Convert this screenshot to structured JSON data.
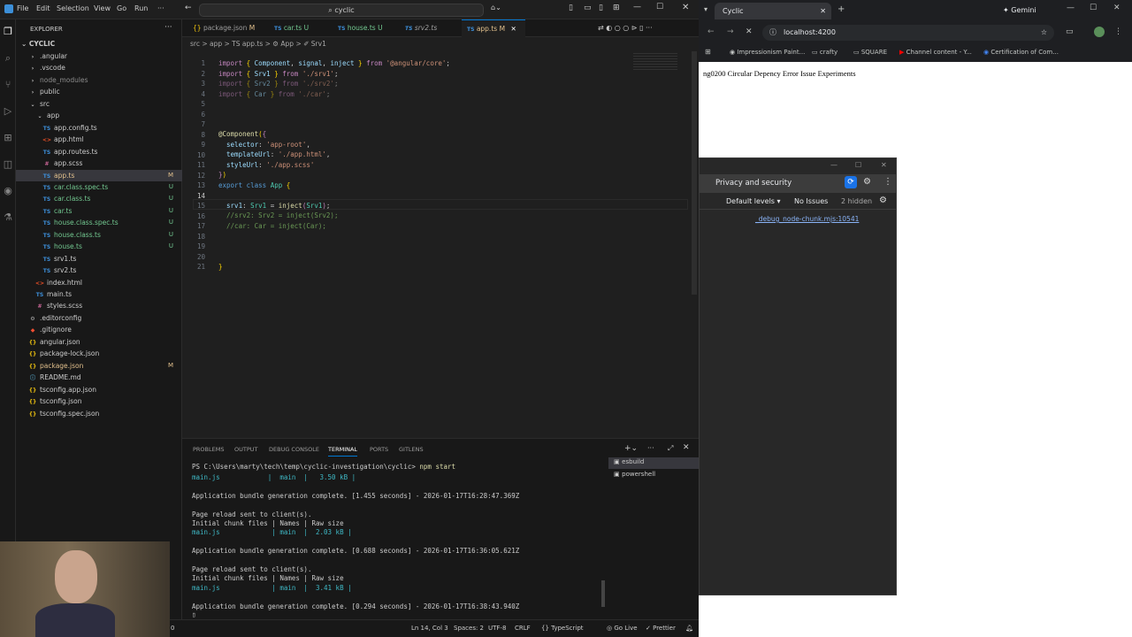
{
  "vscode": {
    "menu": [
      "File",
      "Edit",
      "Selection",
      "View",
      "Go",
      "Run",
      "···"
    ],
    "command_center": "cyclic",
    "explorer": {
      "title": "EXPLORER",
      "root": "CYCLIC",
      "items": [
        {
          "label": ".angular",
          "type": "folder",
          "depth": 1,
          "status": ""
        },
        {
          "label": ".vscode",
          "type": "folder",
          "depth": 1,
          "status": ""
        },
        {
          "label": "node_modules",
          "type": "folder",
          "depth": 1,
          "status": ""
        },
        {
          "label": "public",
          "type": "folder",
          "depth": 1,
          "status": ""
        },
        {
          "label": "src",
          "type": "folder-open",
          "depth": 1,
          "status": ""
        },
        {
          "label": "app",
          "type": "folder-open",
          "depth": 2,
          "status": ""
        },
        {
          "label": "app.config.ts",
          "type": "ts",
          "depth": 3,
          "status": ""
        },
        {
          "label": "app.html",
          "type": "html",
          "depth": 3,
          "status": ""
        },
        {
          "label": "app.routes.ts",
          "type": "ts",
          "depth": 3,
          "status": ""
        },
        {
          "label": "app.scss",
          "type": "scss",
          "depth": 3,
          "status": ""
        },
        {
          "label": "app.ts",
          "type": "ts",
          "depth": 3,
          "status": "M"
        },
        {
          "label": "car.class.spec.ts",
          "type": "ts",
          "depth": 3,
          "status": "U"
        },
        {
          "label": "car.class.ts",
          "type": "ts",
          "depth": 3,
          "status": "U"
        },
        {
          "label": "car.ts",
          "type": "ts",
          "depth": 3,
          "status": "U"
        },
        {
          "label": "house.class.spec.ts",
          "type": "ts",
          "depth": 3,
          "status": "U"
        },
        {
          "label": "house.class.ts",
          "type": "ts",
          "depth": 3,
          "status": "U"
        },
        {
          "label": "house.ts",
          "type": "ts",
          "depth": 3,
          "status": "U"
        },
        {
          "label": "srv1.ts",
          "type": "ts",
          "depth": 3,
          "status": ""
        },
        {
          "label": "srv2.ts",
          "type": "ts",
          "depth": 3,
          "status": ""
        },
        {
          "label": "index.html",
          "type": "html",
          "depth": 2,
          "status": ""
        },
        {
          "label": "main.ts",
          "type": "ts",
          "depth": 2,
          "status": ""
        },
        {
          "label": "styles.scss",
          "type": "scss",
          "depth": 2,
          "status": ""
        },
        {
          "label": ".editorconfig",
          "type": "cfg",
          "depth": 1,
          "status": ""
        },
        {
          "label": ".gitignore",
          "type": "git",
          "depth": 1,
          "status": ""
        },
        {
          "label": "angular.json",
          "type": "json",
          "depth": 1,
          "status": ""
        },
        {
          "label": "package-lock.json",
          "type": "json",
          "depth": 1,
          "status": ""
        },
        {
          "label": "package.json",
          "type": "json",
          "depth": 1,
          "status": "M"
        },
        {
          "label": "README.md",
          "type": "md",
          "depth": 1,
          "status": ""
        },
        {
          "label": "tsconfig.app.json",
          "type": "json",
          "depth": 1,
          "status": ""
        },
        {
          "label": "tsconfig.json",
          "type": "json",
          "depth": 1,
          "status": ""
        },
        {
          "label": "tsconfig.spec.json",
          "type": "json",
          "depth": 1,
          "status": ""
        }
      ]
    },
    "tabs": [
      {
        "label": "package.json",
        "status": "M",
        "icon": "{}"
      },
      {
        "label": "car.ts",
        "status": "U",
        "icon": "TS"
      },
      {
        "label": "house.ts",
        "status": "U",
        "icon": "TS"
      },
      {
        "label": "srv2.ts",
        "status": "",
        "icon": "TS"
      },
      {
        "label": "app.ts",
        "status": "M",
        "icon": "TS",
        "active": true
      }
    ],
    "breadcrumb": "src > app > TS app.ts > ⚙ App > ✐ Srv1",
    "code_lines": [
      "1",
      "2",
      "3",
      "4",
      "5",
      "6",
      "7",
      "8",
      "9",
      "10",
      "11",
      "12",
      "13",
      "14",
      "15",
      "16",
      "17",
      "18",
      "19",
      "20",
      "21"
    ],
    "panel": {
      "tabs": [
        "PROBLEMS",
        "OUTPUT",
        "DEBUG CONSOLE",
        "TERMINAL",
        "PORTS",
        "GITLENS"
      ],
      "terminals": [
        "esbuild",
        "powershell"
      ],
      "prompt": "PS C:\\Users\\marty\\tech\\temp\\cyclic-investigation\\cyclic>",
      "command": "npm start",
      "lines": [
        "main.js            |  main  |   3.50 kB |",
        "",
        "Application bundle generation complete. [1.455 seconds] - 2026-01-17T16:28:47.369Z",
        "",
        "Page reload sent to client(s).",
        "Initial chunk files | Names | Raw size",
        "main.js             | main  |  2.03 kB |",
        "",
        "Application bundle generation complete. [0.688 seconds] - 2026-01-17T16:36:05.621Z",
        "",
        "Page reload sent to client(s).",
        "Initial chunk files | Names | Raw size",
        "main.js             | main  |  3.41 kB |",
        "",
        "Application bundle generation complete. [0.294 seconds] - 2026-01-17T16:38:43.940Z"
      ]
    },
    "status": {
      "problems": "0",
      "position": "Ln 14, Col 3",
      "spaces": "Spaces: 2",
      "encoding": "UTF-8",
      "eol": "CRLF",
      "language": "TypeScript",
      "golive": "Go Live",
      "prettier": "Prettier"
    }
  },
  "browser": {
    "tab_title": "Cyclic",
    "gemini": "Gemini",
    "url": "localhost:4200",
    "bookmarks": [
      "Impressionism Paint...",
      "crafty",
      "SQUARE",
      "Channel content - Y...",
      "Certification of Com..."
    ],
    "page_text": "ng0200 Circular Depency Error Issue Experiments",
    "devtools": {
      "tab": "Privacy and security",
      "levels": "Default levels",
      "issues": "No Issues",
      "hidden": "2 hidden",
      "link": "_debug_node-chunk.mjs:10541"
    }
  }
}
